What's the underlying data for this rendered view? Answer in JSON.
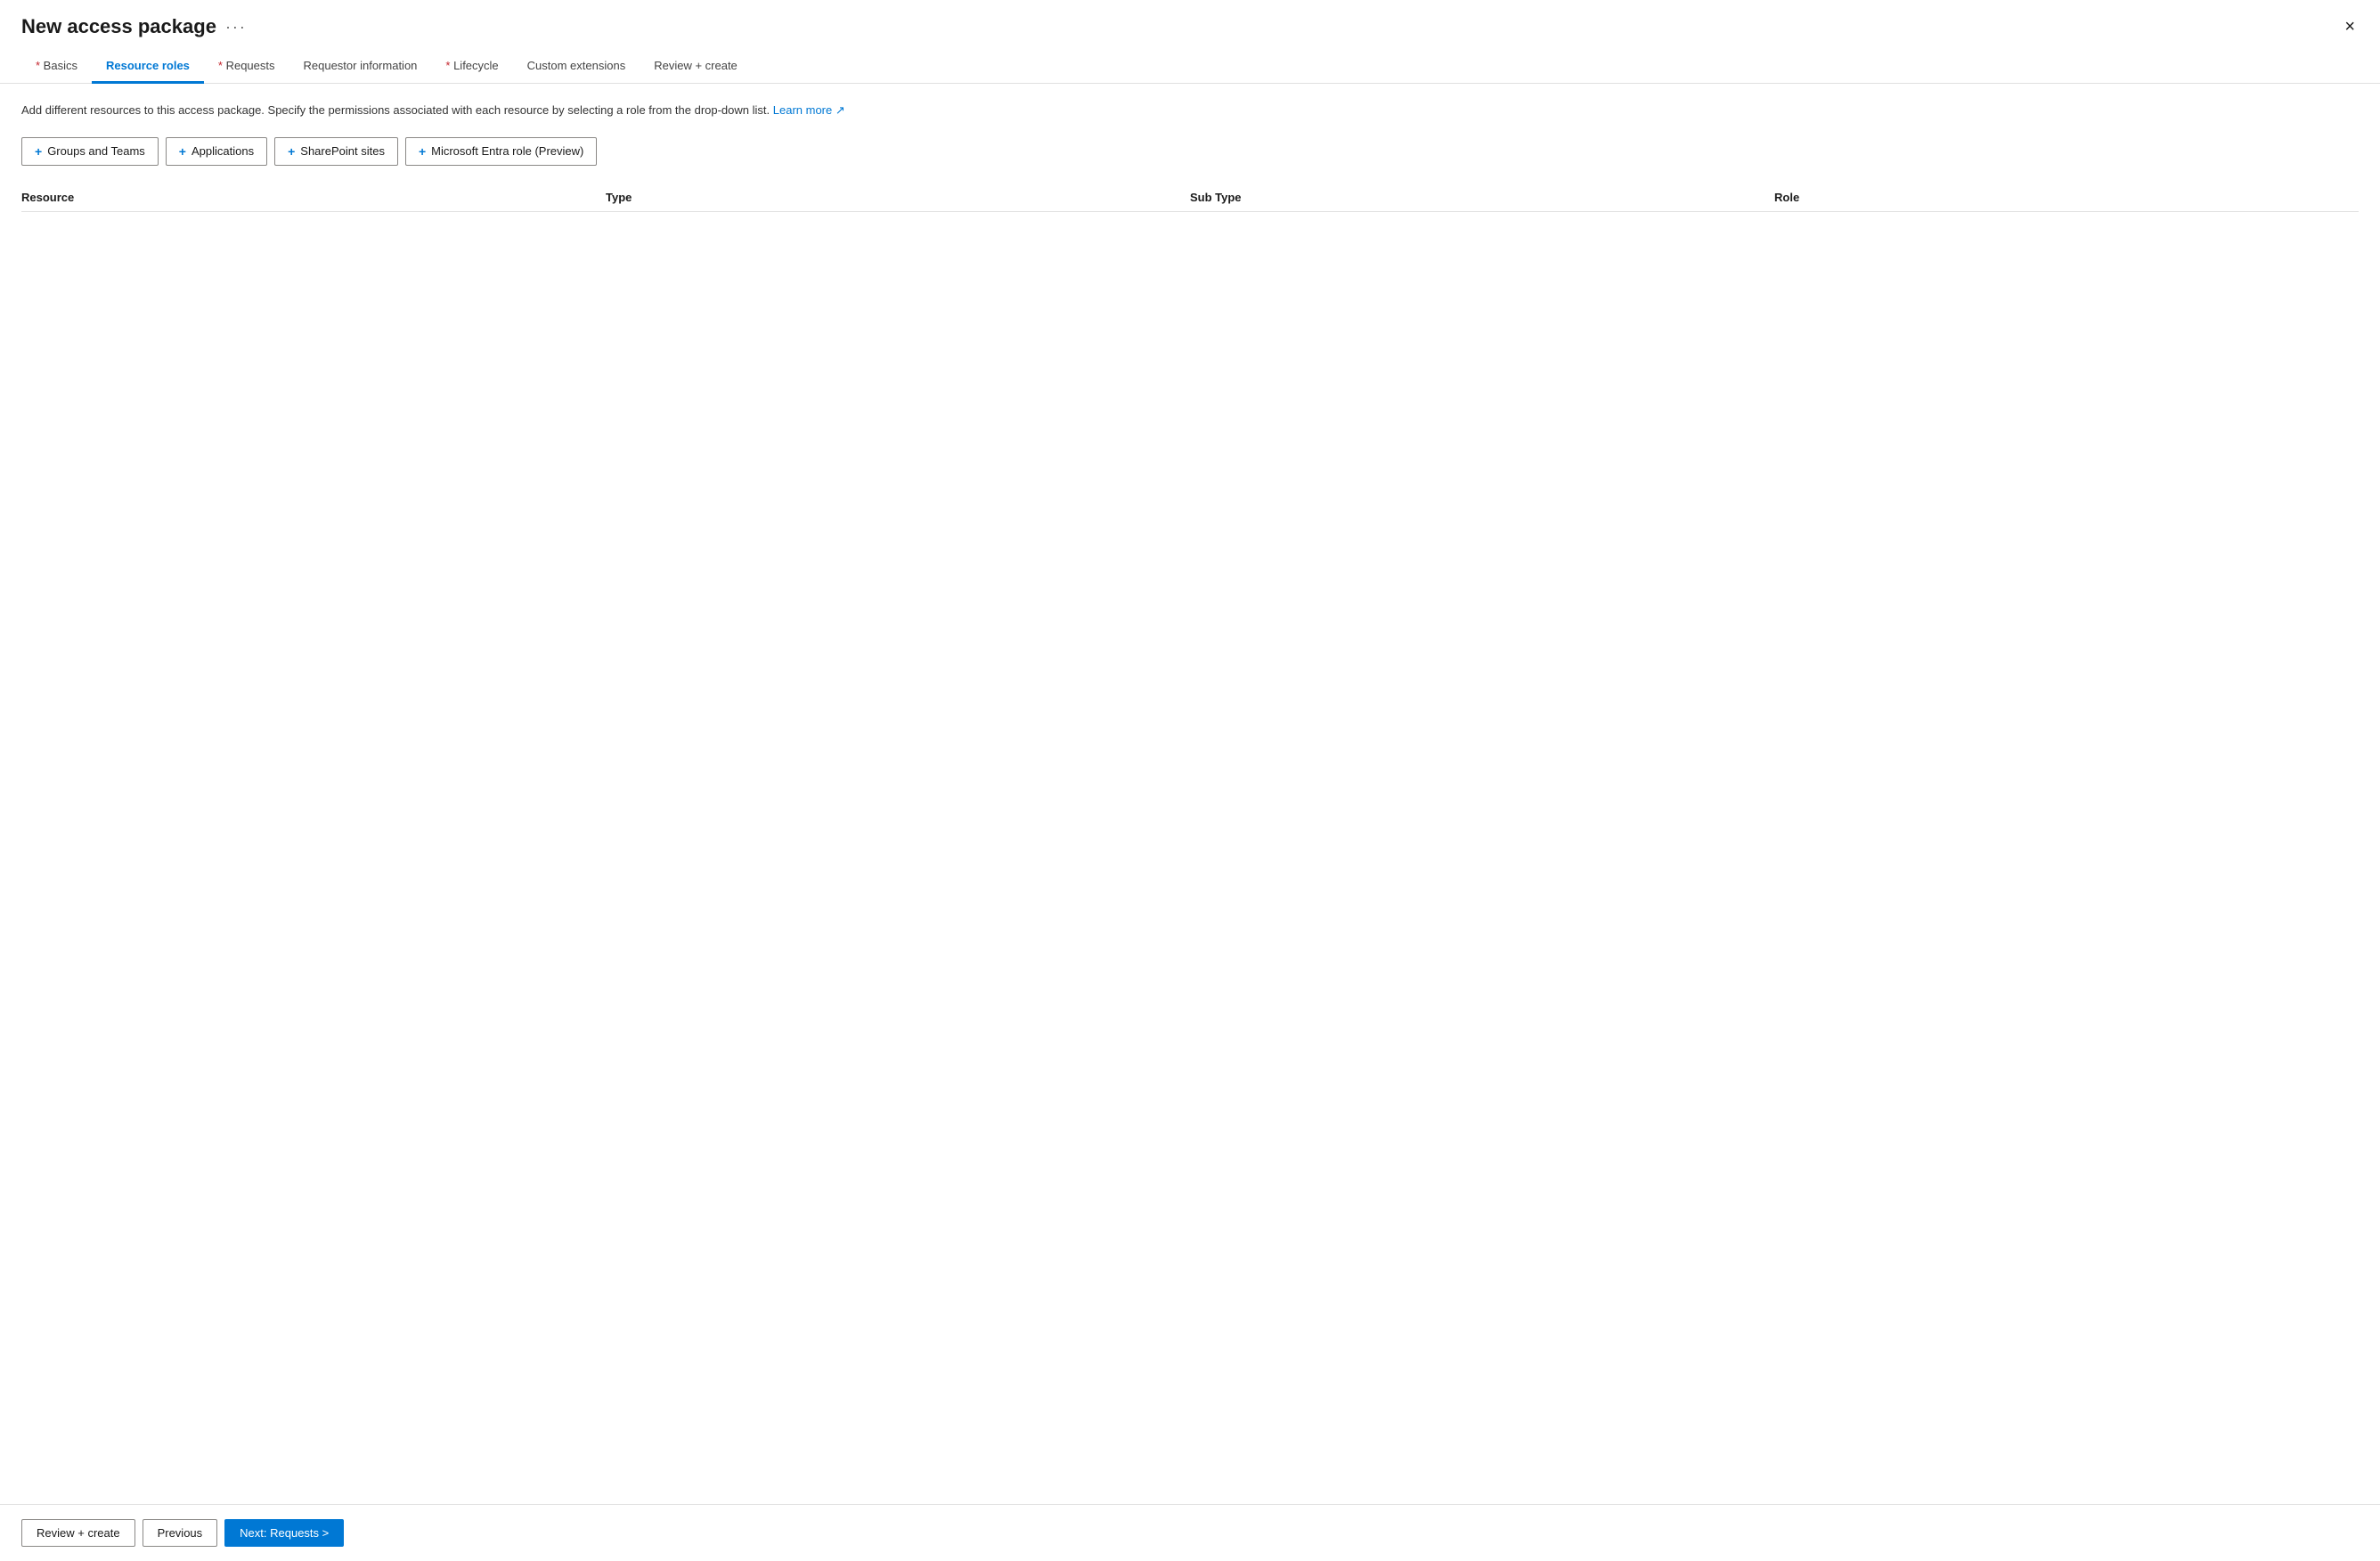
{
  "header": {
    "title": "New access package",
    "more_options_label": "···",
    "close_label": "×"
  },
  "nav": {
    "tabs": [
      {
        "id": "basics",
        "label": "Basics",
        "required": true,
        "active": false
      },
      {
        "id": "resource-roles",
        "label": "Resource roles",
        "required": false,
        "active": true
      },
      {
        "id": "requests",
        "label": "Requests",
        "required": true,
        "active": false
      },
      {
        "id": "requestor-information",
        "label": "Requestor information",
        "required": false,
        "active": false
      },
      {
        "id": "lifecycle",
        "label": "Lifecycle",
        "required": true,
        "active": false
      },
      {
        "id": "custom-extensions",
        "label": "Custom extensions",
        "required": false,
        "active": false
      },
      {
        "id": "review-create",
        "label": "Review + create",
        "required": false,
        "active": false
      }
    ]
  },
  "content": {
    "description": "Add different resources to this access package. Specify the permissions associated with each resource by selecting a role from the drop-down list.",
    "learn_more_label": "Learn more",
    "action_buttons": [
      {
        "id": "groups-and-teams",
        "label": "Groups and Teams"
      },
      {
        "id": "applications",
        "label": "Applications"
      },
      {
        "id": "sharepoint-sites",
        "label": "SharePoint sites"
      },
      {
        "id": "microsoft-entra-role",
        "label": "Microsoft Entra role (Preview)"
      }
    ],
    "table": {
      "columns": [
        {
          "id": "resource",
          "label": "Resource"
        },
        {
          "id": "type",
          "label": "Type"
        },
        {
          "id": "sub-type",
          "label": "Sub Type"
        },
        {
          "id": "role",
          "label": "Role"
        }
      ],
      "rows": []
    }
  },
  "footer": {
    "review_create_label": "Review + create",
    "previous_label": "Previous",
    "next_label": "Next: Requests >"
  }
}
